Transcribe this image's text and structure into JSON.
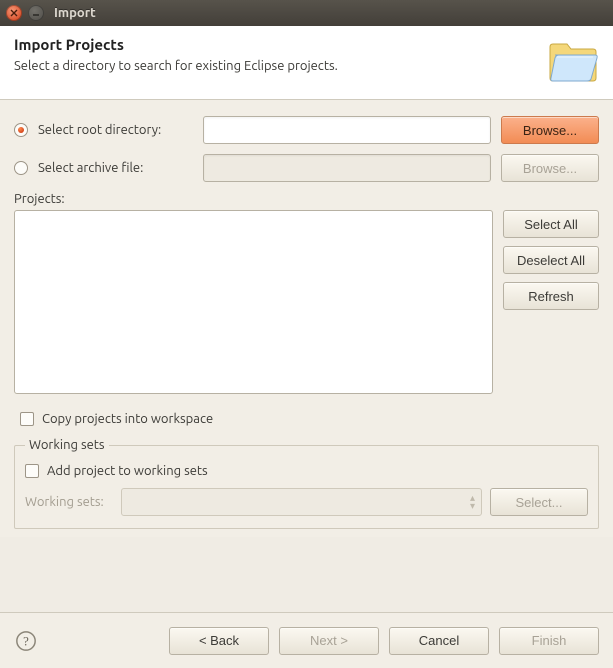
{
  "window": {
    "title": "Import"
  },
  "header": {
    "title": "Import Projects",
    "subtitle": "Select a directory to search for existing Eclipse projects."
  },
  "source": {
    "root_label": "Select root directory:",
    "root_value": "",
    "root_browse": "Browse...",
    "archive_label": "Select archive file:",
    "archive_value": "",
    "archive_browse": "Browse..."
  },
  "projects": {
    "label": "Projects:",
    "buttons": {
      "select_all": "Select All",
      "deselect_all": "Deselect All",
      "refresh": "Refresh"
    }
  },
  "options": {
    "copy_label": "Copy projects into workspace"
  },
  "worksets": {
    "legend": "Working sets",
    "add_label": "Add project to working sets",
    "field_label": "Working sets:",
    "select_btn": "Select..."
  },
  "footer": {
    "back": "< Back",
    "next": "Next >",
    "cancel": "Cancel",
    "finish": "Finish"
  }
}
